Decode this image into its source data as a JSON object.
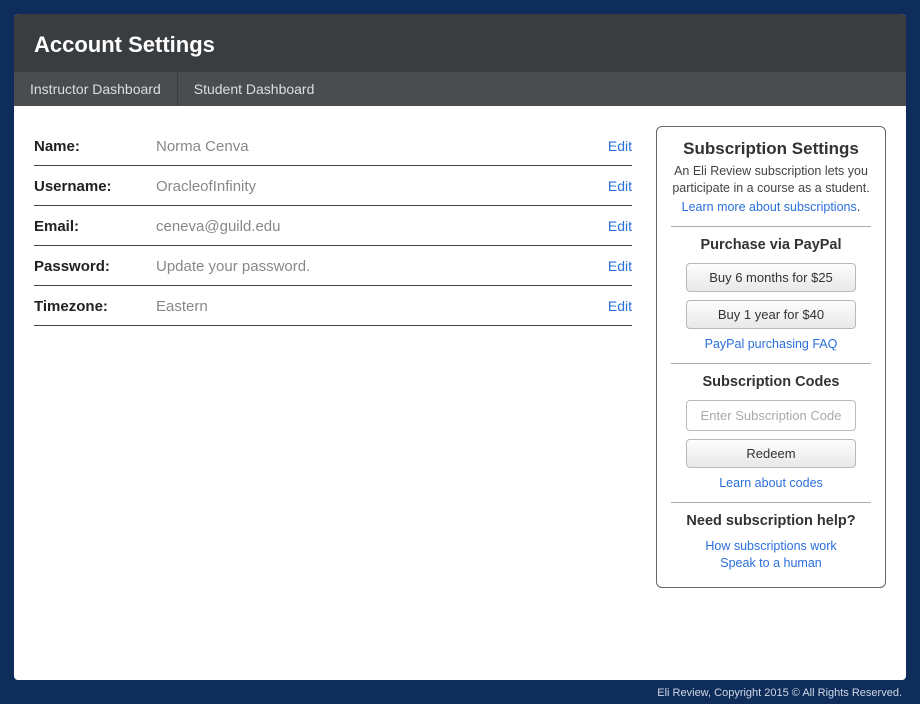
{
  "header": {
    "title": "Account Settings"
  },
  "tabs": {
    "instructor": "Instructor Dashboard",
    "student": "Student Dashboard"
  },
  "fields": {
    "name": {
      "label": "Name:",
      "value": "Norma Cenva",
      "edit": "Edit"
    },
    "username": {
      "label": "Username:",
      "value": "OracleofInfinity",
      "edit": "Edit"
    },
    "email": {
      "label": "Email:",
      "value": "ceneva@guild.edu",
      "edit": "Edit"
    },
    "password": {
      "label": "Password:",
      "value": "Update your password.",
      "edit": "Edit"
    },
    "timezone": {
      "label": "Timezone:",
      "value": "Eastern",
      "edit": "Edit"
    }
  },
  "subscription": {
    "title": "Subscription Settings",
    "desc": "An Eli Review subscription lets you participate in a course as a student.",
    "learn_more": "Learn more about subscriptions",
    "purchase_title": "Purchase via PayPal",
    "buy6": "Buy 6 months for $25",
    "buy12": "Buy 1 year for $40",
    "paypal_faq": "PayPal purchasing FAQ",
    "codes_title": "Subscription Codes",
    "code_placeholder": "Enter Subscription Code",
    "redeem": "Redeem",
    "learn_codes": "Learn about codes",
    "help_title": "Need subscription help?",
    "how_work": "How subscriptions work",
    "speak_human": "Speak to a human"
  },
  "footer": "Eli Review, Copyright 2015 © All Rights Reserved."
}
